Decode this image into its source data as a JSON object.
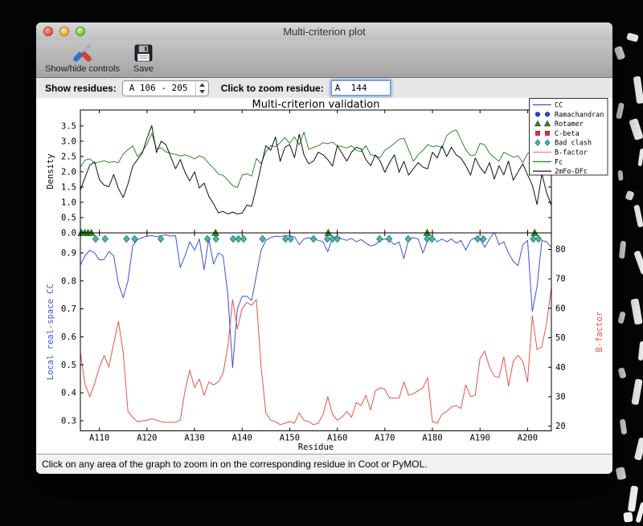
{
  "window": {
    "title": "Multi-criterion plot",
    "toolbar": [
      {
        "label": "Show/hide controls",
        "icon": "tools-icon"
      },
      {
        "label": "Save",
        "icon": "floppy-icon"
      }
    ],
    "controls": {
      "show_residues_label": "Show residues:",
      "range_value": "A 106 - 205",
      "zoom_label": "Click to zoom residue:",
      "zoom_value": "A  144"
    },
    "status_bar": "Click on any area of the graph to zoom in on the corresponding residue in Coot or PyMOL."
  },
  "legend": {
    "entries": [
      {
        "label": "CC",
        "type": "line",
        "color": "#3d52d5"
      },
      {
        "label": "Ramachandran",
        "type": "marker",
        "shape": "circle",
        "fill": "#2743cf",
        "edge": "#1b2f99"
      },
      {
        "label": "Rotamer",
        "type": "marker",
        "shape": "triangle",
        "fill": "#2e8b22",
        "edge": "#1d5c16"
      },
      {
        "label": "C-beta",
        "type": "marker",
        "shape": "square",
        "fill": "#d03a30",
        "edge": "#8f221b"
      },
      {
        "label": "Bad clash",
        "type": "marker",
        "shape": "diamond",
        "fill": "#45b8b0",
        "edge": "#20756e"
      },
      {
        "label": "B-factor",
        "type": "line",
        "color": "#ef8078"
      },
      {
        "label": "Fc",
        "type": "line",
        "color": "#2e8b2e"
      },
      {
        "label": "2mFo-DFc",
        "type": "line",
        "color": "#101010"
      }
    ]
  },
  "chart_data": [
    {
      "type": "line",
      "title": "Multi-criterion validation",
      "ylabel": "Density",
      "x_range": [
        106,
        205
      ],
      "ylim": [
        0,
        4.02
      ],
      "yticks": [
        0.0,
        0.5,
        1.0,
        1.5,
        2.0,
        2.5,
        3.0,
        3.5
      ],
      "ytick_labels": [
        "0.0",
        "0.5",
        "1.0",
        "1.5",
        "2.0",
        "2.5",
        "3.0",
        "3.5"
      ],
      "series": [
        {
          "name": "Fc",
          "color": "#2e8b2e",
          "values": [
            2.15,
            2.38,
            2.42,
            2.28,
            2.32,
            2.36,
            2.3,
            2.33,
            2.3,
            2.58,
            2.72,
            2.85,
            2.5,
            2.65,
            2.9,
            3.25,
            2.75,
            2.78,
            2.65,
            2.6,
            2.57,
            2.52,
            2.55,
            2.5,
            2.42,
            2.52,
            2.46,
            2.27,
            2.12,
            1.92,
            1.88,
            1.72,
            1.55,
            1.48,
            1.9,
            1.93,
            1.86,
            2.43,
            2.27,
            2.65,
            2.86,
            2.82,
            2.95,
            3.12,
            2.93,
            3.14,
            2.88,
            3.3,
            2.73,
            2.8,
            2.85,
            2.95,
            2.92,
            2.97,
            2.85,
            2.82,
            2.78,
            2.85,
            2.7,
            2.66,
            2.85,
            2.56,
            2.52,
            2.46,
            2.7,
            2.8,
            2.93,
            3.06,
            3.1,
            2.72,
            2.34,
            2.56,
            2.7,
            2.89,
            2.82,
            2.85,
            2.78,
            3.18,
            3.31,
            3.37,
            3.05,
            2.72,
            2.53,
            2.55,
            2.93,
            2.88,
            2.6,
            2.46,
            2.34,
            2.64,
            2.56,
            2.48,
            2.52,
            2.3,
            2.6,
            2.64,
            2.6,
            2.55,
            2.65,
            2.6
          ]
        },
        {
          "name": "2mFo-DFc",
          "color": "#101010",
          "values": [
            1.4,
            1.82,
            2.22,
            2.32,
            1.74,
            1.56,
            1.51,
            1.91,
            1.45,
            1.16,
            1.6,
            2.18,
            2.4,
            2.6,
            3.1,
            3.51,
            2.63,
            3.0,
            2.88,
            2.48,
            2.1,
            2.4,
            1.98,
            1.7,
            2.0,
            1.47,
            1.63,
            1.2,
            0.95,
            0.66,
            0.7,
            0.62,
            0.68,
            0.62,
            0.65,
            0.91,
            0.87,
            1.5,
            2.2,
            2.85,
            2.7,
            3.14,
            2.34,
            2.8,
            2.89,
            2.46,
            3.23,
            2.55,
            2.26,
            2.35,
            2.64,
            2.55,
            2.4,
            2.18,
            2.85,
            2.6,
            2.35,
            2.64,
            2.8,
            2.75,
            2.4,
            2.2,
            2.55,
            2.35,
            1.98,
            2.3,
            2.56,
            1.98,
            2.34,
            1.89,
            2.1,
            2.3,
            2.15,
            2.1,
            2.64,
            2.45,
            2.85,
            2.5,
            2.8,
            2.55,
            2.45,
            2.2,
            1.89,
            2.45,
            2.15,
            1.95,
            2.3,
            1.76,
            2.2,
            1.9,
            2.35,
            1.72,
            2.0,
            2.26,
            1.9,
            1.56,
            0.93,
            1.93,
            1.31,
            0.9
          ]
        }
      ]
    },
    {
      "type": "line",
      "xlabel": "Residue",
      "x_range": [
        106,
        205
      ],
      "xticks": [
        110,
        120,
        130,
        140,
        150,
        160,
        170,
        180,
        190,
        200
      ],
      "xtick_labels": [
        "A110",
        "A120",
        "A130",
        "A140",
        "A150",
        "A160",
        "A170",
        "A180",
        "A190",
        "A200"
      ],
      "left": {
        "label": "Local real-space CC",
        "color": "#3d52d5",
        "lim": [
          0.264,
          0.9718
        ],
        "ticks": [
          0.3,
          0.4,
          0.5,
          0.6,
          0.7,
          0.8,
          0.9
        ],
        "tick_labels": [
          "0.3",
          "0.4",
          "0.5",
          "0.6",
          "0.7",
          "0.8",
          "0.9"
        ],
        "series": {
          "name": "CC",
          "color": "#3d52d5",
          "values": [
            0.857,
            0.89,
            0.91,
            0.9,
            0.875,
            0.877,
            0.905,
            0.89,
            0.79,
            0.74,
            0.8,
            0.925,
            0.948,
            0.955,
            0.96,
            0.962,
            0.958,
            0.962,
            0.965,
            0.96,
            0.962,
            0.848,
            0.89,
            0.94,
            0.91,
            0.95,
            0.84,
            0.95,
            0.86,
            0.9,
            0.89,
            0.75,
            0.49,
            0.7,
            0.745,
            0.745,
            0.73,
            0.82,
            0.91,
            0.945,
            0.955,
            0.96,
            0.958,
            0.962,
            0.96,
            0.958,
            0.93,
            0.95,
            0.955,
            0.95,
            0.945,
            0.94,
            0.905,
            0.955,
            0.96,
            0.95,
            0.945,
            0.952,
            0.94,
            0.948,
            0.935,
            0.925,
            0.93,
            0.945,
            0.95,
            0.945,
            0.93,
            0.94,
            0.88,
            0.95,
            0.955,
            0.95,
            0.9,
            0.945,
            0.96,
            0.94,
            0.95,
            0.94,
            0.95,
            0.935,
            0.945,
            0.91,
            0.945,
            0.955,
            0.95,
            0.92,
            0.95,
            0.975,
            0.93,
            0.94,
            0.9,
            0.87,
            0.855,
            0.93,
            0.945,
            0.69,
            0.78,
            0.945,
            0.94,
            0.92
          ]
        }
      },
      "right": {
        "label": "B-factor",
        "color": "#e8534a",
        "lim": [
          18.4,
          85.6
        ],
        "ticks": [
          20,
          30,
          40,
          50,
          60,
          70,
          80
        ],
        "tick_labels": [
          "20",
          "30",
          "40",
          "50",
          "60",
          "70",
          "80"
        ],
        "series": {
          "name": "B-factor",
          "color": "#e8534a",
          "values": [
            45,
            34,
            30,
            34.5,
            40,
            44,
            40,
            48,
            55.5,
            45,
            25,
            23,
            21.5,
            21.8,
            22,
            22.5,
            22,
            21.5,
            21.3,
            21.3,
            21.3,
            22,
            32,
            39,
            33,
            36,
            30.5,
            35,
            34,
            35,
            38,
            47,
            63,
            53,
            60,
            62,
            61,
            63,
            40,
            24.5,
            22,
            21.5,
            20.5,
            21,
            21.5,
            21,
            24.5,
            22,
            21.5,
            20.5,
            21,
            24,
            30,
            24,
            22,
            23,
            25,
            23,
            28,
            27,
            30.5,
            25.5,
            32,
            33,
            32.5,
            29.5,
            29.5,
            29.5,
            35,
            30.5,
            31,
            32,
            33,
            36.5,
            21.5,
            21,
            24,
            25,
            26.5,
            27,
            26,
            34,
            30,
            30.5,
            43,
            45.5,
            40,
            37,
            36.5,
            43.5,
            33.5,
            42,
            44,
            42,
            35,
            57.5,
            46,
            47,
            55,
            67
          ]
        }
      },
      "markers": [
        {
          "name": "Rotamer",
          "shape": "triangle",
          "fill": "#2e8b22",
          "edge": "#1d5c16",
          "residues": [
            106.2,
            106.9,
            107.6,
            108.3,
            134.4,
            158.1,
            178.9,
            201.5
          ]
        },
        {
          "name": "Bad clash",
          "shape": "diamond",
          "fill": "#45b8b0",
          "edge": "#20756e",
          "residues": [
            109.2,
            111.2,
            115.7,
            117.4,
            122.9,
            132.7,
            134.5,
            138.1,
            139.2,
            140.3,
            144.3,
            149.1,
            150.2,
            155.0,
            157.9,
            159.0,
            160.0,
            168.9,
            170.9,
            174.9,
            178.9,
            179.9,
            189.5,
            190.7,
            201.2,
            202.3
          ]
        }
      ]
    }
  ]
}
